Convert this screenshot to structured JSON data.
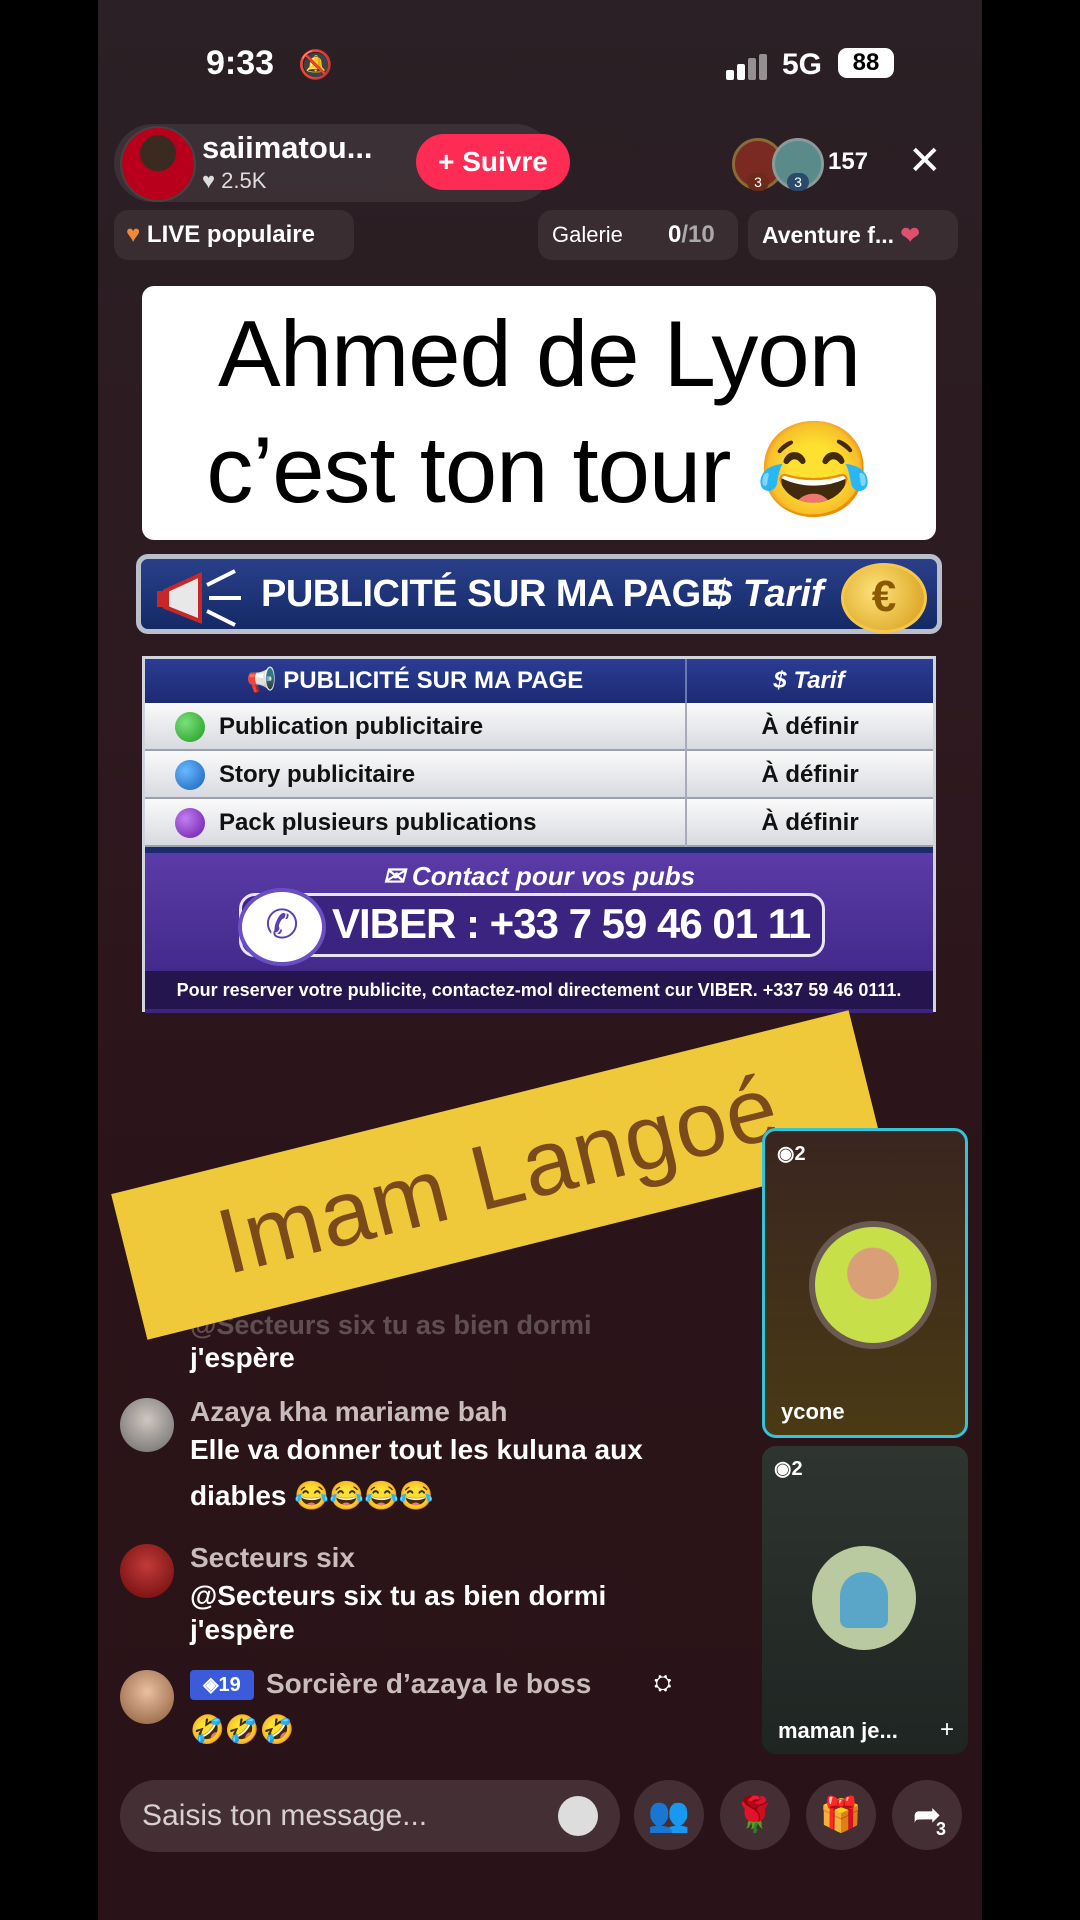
{
  "status_bar": {
    "time": "9:33",
    "network": "5G",
    "battery": "88"
  },
  "host": {
    "name": "saiimatou...",
    "likes": "♥ 2.5K",
    "follow_label": "+ Suivre"
  },
  "viewers": {
    "count": "157",
    "badge1": "3",
    "badge2": "3"
  },
  "pills": {
    "live": "LIVE populaire",
    "gallery_label": "Galerie",
    "gallery_count": "0",
    "gallery_total": "/10",
    "adventure": "Aventure f..."
  },
  "caption": {
    "line1": "Ahmed de Lyon",
    "line2": "c’est ton tour 😂"
  },
  "ad": {
    "banner_title": "PUBLICITÉ SUR MA PAGE",
    "banner_tarif": "$ Tarif",
    "coin_symbol": "€",
    "table_header_left": "📢 PUBLICITÉ SUR MA PAGE",
    "table_header_right": "$ Tarif",
    "rows": [
      {
        "label": "Publication publicitaire",
        "value": "À définir",
        "color": "#2bb52b"
      },
      {
        "label": "Story publicitaire",
        "value": "À définir",
        "color": "#1e7fd6"
      },
      {
        "label": "Pack plusieurs publications",
        "value": "À définir",
        "color": "#8a2bc9"
      }
    ],
    "contact": "✉ Contact pour vos pubs",
    "viber": "VIBER : +33 7 59 46 01 11",
    "footer": "Pour reserver votre publicite, contactez-mol directement cur VIBER. +337 59 46 0111."
  },
  "sticker": "Imam Langoé",
  "cards": [
    {
      "badge": "◉2",
      "name": "ycone"
    },
    {
      "badge": "◉2",
      "name": "maman je...",
      "plus": "+"
    }
  ],
  "comments": {
    "faded": "@Secteurs six tu as bien dormi",
    "faded_cont": "j'espère",
    "items": [
      {
        "name": "Azaya kha mariame bah",
        "text1": "Elle va donner tout les kuluna aux",
        "text2": "diables 😂😂😂😂"
      },
      {
        "name": "Secteurs six",
        "text1": "@Secteurs six tu as bien dormi",
        "text2": "j'espère"
      },
      {
        "name": "Sorcière d’azaya le boss",
        "level": "◈19",
        "text1": "🤣🤣🤣"
      }
    ]
  },
  "bottom": {
    "placeholder": "Saisis ton message...",
    "share_count": "3"
  }
}
